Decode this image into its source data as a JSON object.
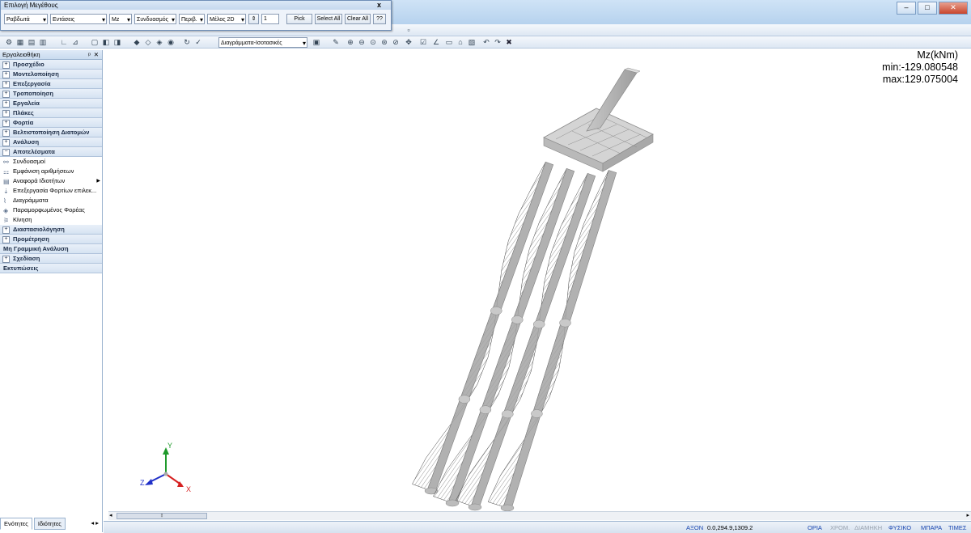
{
  "window": {
    "title": "Επιλογή Μεγέθους",
    "close_glyph": "x"
  },
  "selector": {
    "element_type": "Ραβδωτά",
    "result_type": "Εντάσεις",
    "component": "Mz",
    "combination": "Συνδυασμός",
    "envelope": "Περιβ.",
    "member": "Μέλος 2D",
    "stepper_value": "1",
    "pick_label": "Pick",
    "select_all_label": "Select All",
    "clear_all_label": "Clear All",
    "help_label": "??"
  },
  "toolbar": {
    "view_combo": "Διαγράμματα-Ισοτασικές"
  },
  "toolbox": {
    "title": "Εργαλειοθήκη",
    "pin": "ᵖ",
    "close": "✕",
    "categories_top": [
      {
        "label": "Προσχέδιο",
        "sign": "+"
      },
      {
        "label": "Μοντελοποίηση",
        "sign": "+"
      },
      {
        "label": "Επεξεργασία",
        "sign": "+"
      },
      {
        "label": "Τροποποίηση",
        "sign": "+"
      },
      {
        "label": "Εργαλεία",
        "sign": "+"
      },
      {
        "label": "Πλάκες",
        "sign": "+"
      },
      {
        "label": "Φορτία",
        "sign": "+"
      },
      {
        "label": "Βελτιστοποίηση Διατομών",
        "sign": "+"
      },
      {
        "label": "Ανάλυση",
        "sign": "+"
      },
      {
        "label": "Αποτελέσματα",
        "sign": "−"
      }
    ],
    "results_items": [
      {
        "label": "Συνδυασμοί",
        "icon": "combinations-icon"
      },
      {
        "label": "Εμφάνιση αριθμήσεων",
        "icon": "numbering-icon"
      },
      {
        "label": "Αναφορά Ιδιοτήτων",
        "icon": "properties-icon"
      },
      {
        "label": "Επεξεργασία Φορτίων επιλεκ...",
        "icon": "load-edit-icon"
      },
      {
        "label": "Διαγράμματα",
        "icon": "diagrams-icon"
      },
      {
        "label": "Παραμορφωμένος Φορέας",
        "icon": "deformed-icon"
      },
      {
        "label": "Κίνηση",
        "icon": "animation-icon"
      }
    ],
    "categories_bottom": [
      {
        "label": "Διαστασιολόγηση",
        "sign": "+"
      },
      {
        "label": "Προμέτρηση",
        "sign": "+"
      },
      {
        "label": "Μη Γραμμική Ανάλυση",
        "sign": ""
      },
      {
        "label": "Σχεδίαση",
        "sign": "+"
      },
      {
        "label": "Εκτυπώσεις",
        "sign": ""
      }
    ],
    "tabs": [
      "Ενότητες",
      "Ιδιότητες"
    ]
  },
  "legend": {
    "quantity": "Mz(kNm)",
    "min": "min:-129.080548",
    "max": "max:129.075004"
  },
  "axes": {
    "y": "Y",
    "x": "X",
    "z": "Z"
  },
  "status": {
    "axis_label": "ΑΞΟΝ",
    "coords": "0.0,294.9,1309.2",
    "modes": [
      {
        "label": "ΟΡΙΑ",
        "on": true
      },
      {
        "label": "ΧΡΟΜ.",
        "on": false
      },
      {
        "label": "ΔΙΑΜΗΚΗ",
        "on": false
      },
      {
        "label": "ΦΥΣΙΚΟ",
        "on": true
      },
      {
        "label": "ΜΠΑΡΑ",
        "on": true
      },
      {
        "label": "ΤΙΜΕΣ",
        "on": true
      }
    ]
  },
  "colors": {
    "accent": "#1845b0",
    "axis_x": "#d62020",
    "axis_y": "#1f9a2b",
    "axis_z": "#2030c8"
  }
}
